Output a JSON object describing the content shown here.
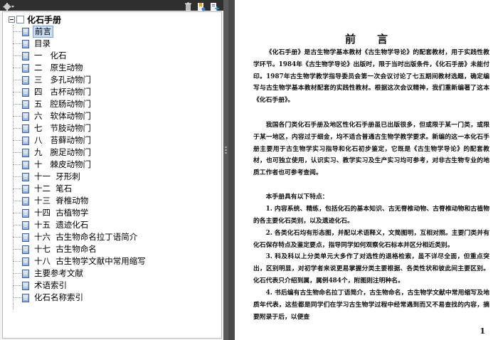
{
  "toolbar": {
    "icons": [
      "settings-icon",
      "trash-icon",
      "bookmark-new-icon",
      "bookmark-add-icon"
    ]
  },
  "tree": {
    "root_label": "化石手册",
    "items": [
      {
        "label": "前言",
        "selected": true
      },
      {
        "label": "目录"
      },
      {
        "label": "一   化石"
      },
      {
        "label": "二   原生动物"
      },
      {
        "label": "三   多孔动物门"
      },
      {
        "label": "四   古杯动物门"
      },
      {
        "label": "五   腔肠动物门"
      },
      {
        "label": "六   软体动物门"
      },
      {
        "label": "七   节肢动物门"
      },
      {
        "label": "八   苔藓动物门"
      },
      {
        "label": "九   腕足动物门"
      },
      {
        "label": "十   棘皮动物门"
      },
      {
        "label": "十一  牙形刺"
      },
      {
        "label": "十二  笔石"
      },
      {
        "label": "十三  脊椎动物"
      },
      {
        "label": "十四  古植物学"
      },
      {
        "label": "十五  遗迹化石"
      },
      {
        "label": "十六  古生物命名拉丁语简介"
      },
      {
        "label": "十七  古生物命名"
      },
      {
        "label": "十八  古生物学文献中常用缩写"
      },
      {
        "label": "主要参考文献"
      },
      {
        "label": "术语索引"
      },
      {
        "label": "化石名称索引"
      }
    ]
  },
  "document": {
    "title": "前　　言",
    "paragraphs": [
      "《化石手册》是古生物学基本教材《古生物学导论》的配套教材，用于实践性教学环节。1984年《古生物学导论》出版时，限于当时出版条件，《化石手册》未能付印。1987年古生物学教学指导委员会第一次会议讨论了七五期间教材选题，确定编写与古生物学基本教材配套的实践性教材。根据这次会议精神，我们重新编著了这本《化石手册》。",
      "我国各门类化石手册及地区性化石手册虽已出版很多，但或限于某一门类，或限于某一地区，内容过于细金，均不适合普通古生物学教学要求。新编的这一本化石手册主要用于古生物学实习指导和化石初步鉴定，它既是《古生物学导论》的配套教材，也可独立使用，认识实习、教学实习及生产实习均可参考，对非古生物专业的地质工作者也可参考查阅。",
      "本手册具有以下特点：",
      "1. 内容系统、精练，包括化石的基本知识、古无脊椎动物、古脊椎动物和古植物的各主要化石类别，以及遗迹化石。",
      "2. 各类化石均有形态图，并配以术语释义，文简图明，互相对照。主要门类并有化石保存特点及鉴定要点，指导同学如何观察化石标本并区分相近类别。",
      "3. 科及科以上分类单元大多作了对选性的退格检索，虽不详尽全面，但重点突出，区别明显，对初学者来说更易掌握分类主要根据、各类性状和彼此间主要区别。化石代表只介绍到属，属例484个，附图则注明种名。",
      "4. 书后编有古生物命名拉丁语简介，古生物命名，古生物学文献中常用缩写及地质年代表，这些都是同学们在学习古生物学过程中经常遇到而又不易查找的内容，摘要附录于后，以便查"
    ],
    "page_number": "1"
  }
}
